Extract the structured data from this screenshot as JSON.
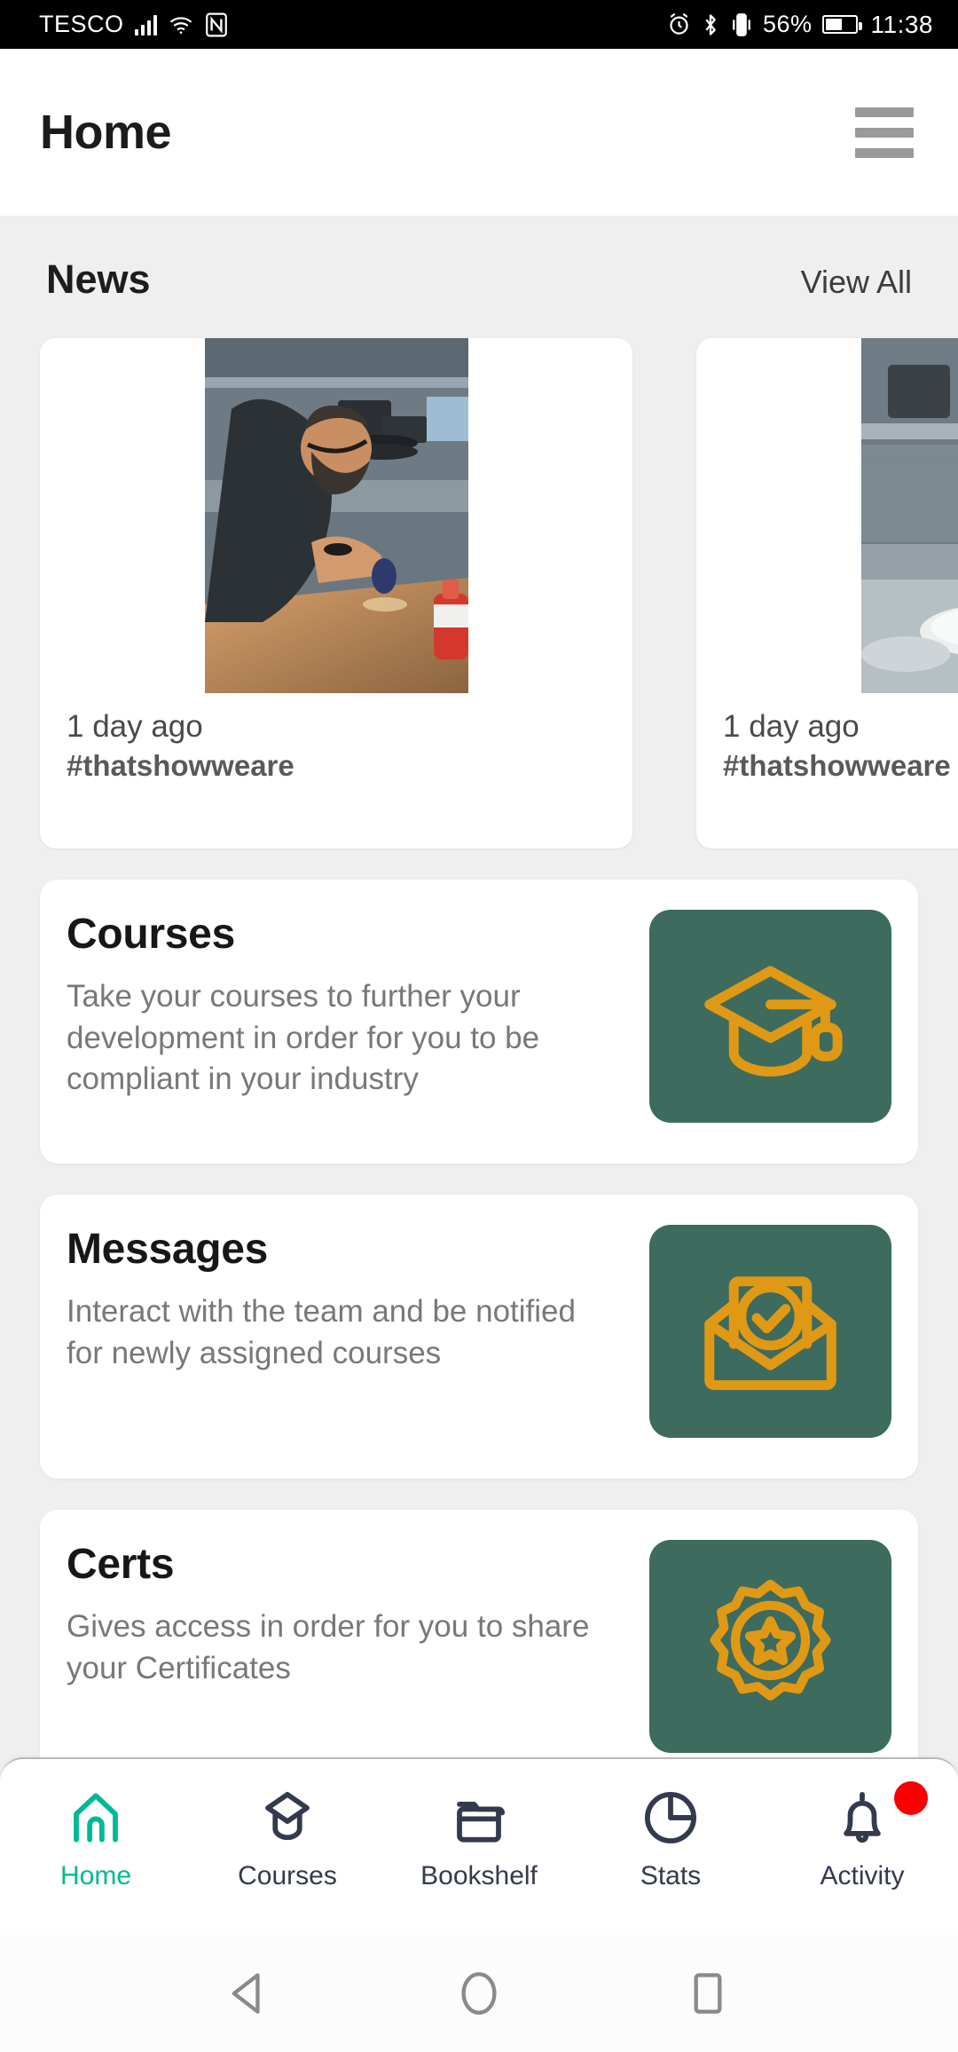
{
  "statusbar": {
    "carrier": "TESCO",
    "signal_icon": "signal-bars-icon",
    "wifi_icon": "wifi-icon",
    "nfc_icon": "nfc-icon",
    "alarm_icon": "alarm-clock-icon",
    "bluetooth_icon": "bluetooth-icon",
    "vibrate_icon": "vibrate-icon",
    "battery_percent": "56%",
    "battery_icon": "battery-icon",
    "time": "11:38"
  },
  "header": {
    "title": "Home",
    "menu_icon": "hamburger-menu-icon"
  },
  "news": {
    "title": "News",
    "view_all": "View All",
    "cards": [
      {
        "time": "1 day ago",
        "tag": "#thatshowweare",
        "image": "kitchen-chef-photo"
      },
      {
        "time": "1 day ago",
        "tag": "#thatshowweare",
        "image": "kitchen-plates-photo"
      }
    ]
  },
  "features": [
    {
      "title": "Courses",
      "description": "Take your courses to further your development in order for you to be compliant in your industry",
      "icon": "graduation-cap-icon"
    },
    {
      "title": "Messages",
      "description": "Interact with the team and be notified for newly assigned courses",
      "icon": "envelope-check-icon"
    },
    {
      "title": "Certs",
      "description": "Gives access in order for you to share your Certificates",
      "icon": "award-badge-icon"
    }
  ],
  "bottom_nav": {
    "items": [
      {
        "label": "Home",
        "icon": "home-icon",
        "active": true,
        "badge": false
      },
      {
        "label": "Courses",
        "icon": "graduation-cap-icon",
        "active": false,
        "badge": false
      },
      {
        "label": "Bookshelf",
        "icon": "folder-icon",
        "active": false,
        "badge": false
      },
      {
        "label": "Stats",
        "icon": "pie-chart-icon",
        "active": false,
        "badge": false
      },
      {
        "label": "Activity",
        "icon": "bell-icon",
        "active": false,
        "badge": true
      }
    ]
  },
  "android_nav": {
    "back_icon": "back-triangle-icon",
    "home_icon": "home-circle-icon",
    "recents_icon": "recents-square-icon"
  },
  "colors": {
    "accent_green": "#3d6b5e",
    "accent_orange": "#e09914",
    "active_nav": "#00b894",
    "badge_red": "#f90000",
    "page_bg": "#efefef",
    "card_bg": "#ffffff"
  }
}
